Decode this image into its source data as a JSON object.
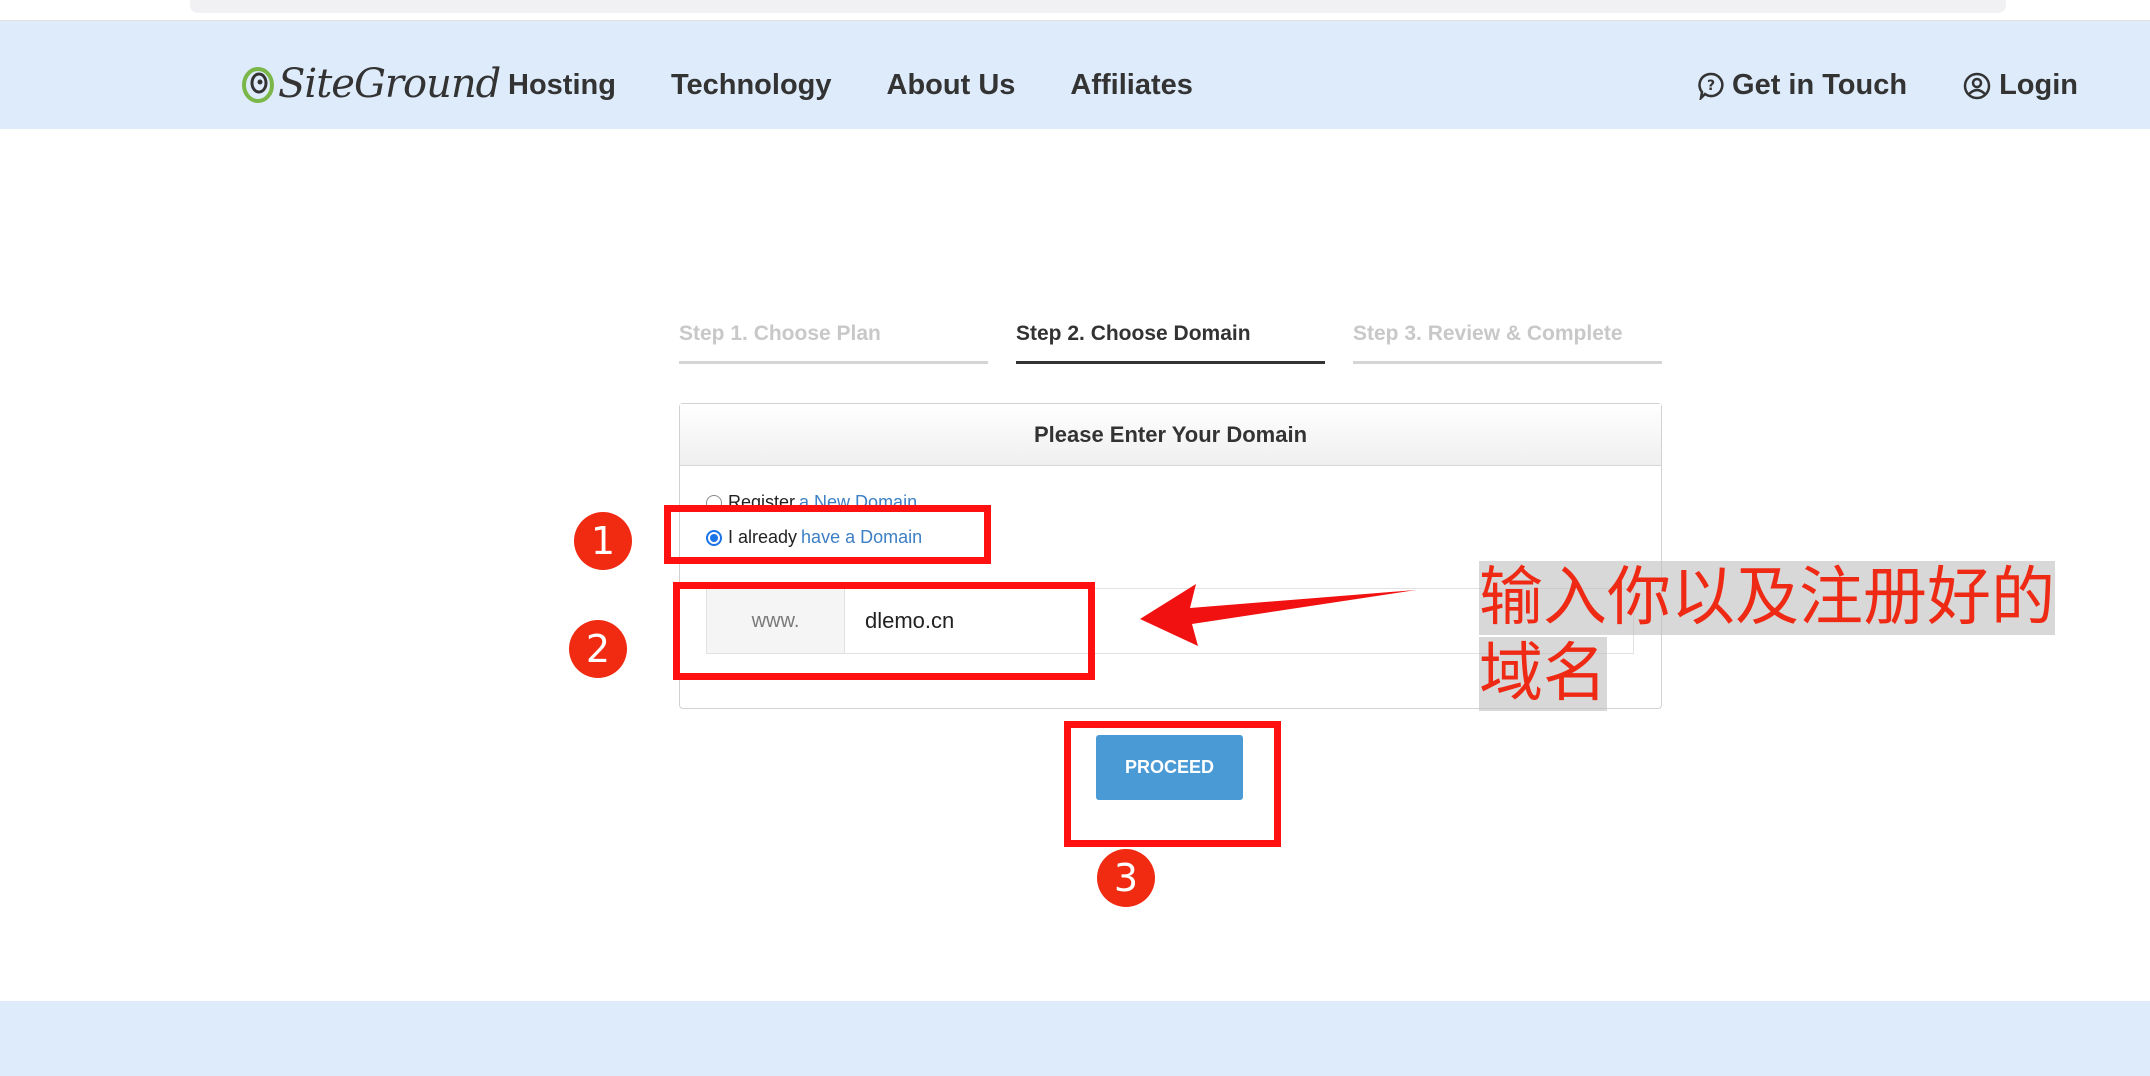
{
  "header": {
    "logo_text": "SiteGround",
    "nav": [
      "Hosting",
      "Technology",
      "About Us",
      "Affiliates"
    ],
    "get_in_touch": "Get in Touch",
    "login": "Login"
  },
  "steps": [
    {
      "label": "Step 1. Choose Plan",
      "active": false
    },
    {
      "label": "Step 2. Choose Domain",
      "active": true
    },
    {
      "label": "Step 3. Review & Complete",
      "active": false
    }
  ],
  "panel": {
    "title": "Please Enter Your Domain",
    "options": [
      {
        "prefix": "Register",
        "link": "a New Domain",
        "checked": false
      },
      {
        "prefix": "I already",
        "link": "have a Domain",
        "checked": true
      }
    ],
    "domain_prefix": "www.",
    "domain_value": "dlemo.cn"
  },
  "proceed_label": "PROCEED",
  "annotations": {
    "step_numbers": [
      "1",
      "2",
      "3"
    ],
    "note_line1": "输入你以及注册好的",
    "note_line2": "域名",
    "color": "#f11111"
  },
  "colors": {
    "header_bg": "#ddebfb",
    "link": "#3d7fc4",
    "button": "#4a9ad6",
    "logo_green": "#7ab648"
  }
}
